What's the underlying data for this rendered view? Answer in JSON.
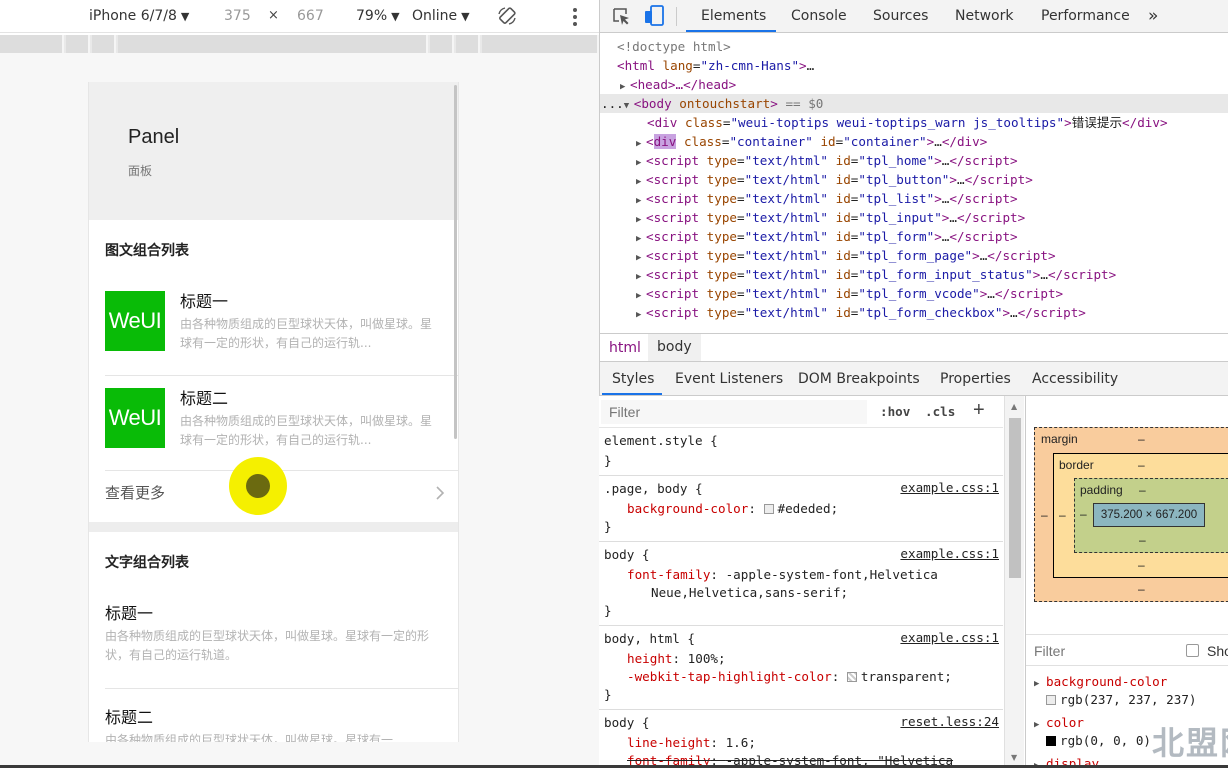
{
  "device_toolbar": {
    "device_name": "iPhone 6/7/8",
    "width": "375",
    "times": "×",
    "height": "667",
    "zoom": "79%",
    "network": "Online"
  },
  "phone": {
    "panel_title": "Panel",
    "panel_subtitle": "面板",
    "section1_title": "图文组合列表",
    "media_items": [
      {
        "thumb": "WeUI",
        "title": "标题一",
        "desc": "由各种物质组成的巨型球状天体，叫做星球。星球有一定的形状，有自己的运行轨..."
      },
      {
        "thumb": "WeUI",
        "title": "标题二",
        "desc": "由各种物质组成的巨型球状天体，叫做星球。星球有一定的形状，有自己的运行轨..."
      }
    ],
    "more_label": "查看更多",
    "section2_title": "文字组合列表",
    "text_items": [
      {
        "title": "标题一",
        "desc": "由各种物质组成的巨型球状天体，叫做星球。星球有一定的形状，有自己的运行轨道。"
      },
      {
        "title": "标题二",
        "desc": "由各种物质组成的巨型球状天体，叫做星球。星球有一"
      }
    ]
  },
  "devtools": {
    "tabs": [
      "Elements",
      "Console",
      "Sources",
      "Network",
      "Performance"
    ],
    "more_tabs": "»",
    "dom": {
      "doctype": "<!doctype html>",
      "html_open_tag": "html",
      "html_lang_attr": "lang",
      "html_lang_val": "\"zh-cmn-Hans\"",
      "html_tail": "…",
      "head": "<head>…</head>",
      "body_prefix": "...",
      "body_open": "<body",
      "body_attr": "ontouchstart",
      "body_close": ">",
      "body_eq": "== $0",
      "toptips_attr_val": "\"weui-toptips weui-toptips_warn js_tooltips\"",
      "toptips_text": "错误提示",
      "container_class": "\"container\"",
      "container_id": "\"container\"",
      "scripts": [
        "\"tpl_home\"",
        "\"tpl_button\"",
        "\"tpl_list\"",
        "\"tpl_input\"",
        "\"tpl_form\"",
        "\"tpl_form_page\"",
        "\"tpl_form_input_status\"",
        "\"tpl_form_vcode\"",
        "\"tpl_form_checkbox\""
      ]
    },
    "breadcrumbs": [
      "html",
      "body"
    ],
    "sub_tabs": [
      "Styles",
      "Event Listeners",
      "DOM Breakpoints",
      "Properties",
      "Accessibility"
    ],
    "styles": {
      "filter_placeholder": "Filter",
      "hov": ":hov",
      "cls": ".cls",
      "plus": "+",
      "element_style": "element.style {",
      "rule_close": "}",
      "rule1_selector": ".page, body {",
      "rule1_source": "example.css:1",
      "rule1_prop": "background-color",
      "rule1_val": "#ededed;",
      "rule2_selector": "body {",
      "rule2_source": "example.css:1",
      "rule2_prop": "font-family",
      "rule2_val": "-apple-system-font,Helvetica",
      "rule2_val_cont": "Neue,Helvetica,sans-serif;",
      "rule3_selector": "body, html {",
      "rule3_source": "example.css:1",
      "rule3_prop1": "height",
      "rule3_val1": "100%;",
      "rule3_prop2": "-webkit-tap-highlight-color",
      "rule3_val2": "transparent;",
      "rule4_selector": "body {",
      "rule4_source": "reset.less:24",
      "rule4_prop1": "line-height",
      "rule4_val1": "1.6;",
      "rule4_prop2": "font-family",
      "rule4_val2": "-apple-system-font, \"Helvetica"
    },
    "box_model": {
      "margin": "margin",
      "border": "border",
      "padding": "padding",
      "dash": "–",
      "content": "375.200 × 667.200"
    },
    "computed": {
      "filter_placeholder": "Filter",
      "show_all": "Sho",
      "props": [
        {
          "name": "background-color",
          "value": "rgb(237, 237, 237)"
        },
        {
          "name": "color",
          "value": "rgb(0, 0, 0)"
        },
        {
          "name": "display",
          "value": ""
        }
      ]
    }
  },
  "watermark": "北盟网"
}
